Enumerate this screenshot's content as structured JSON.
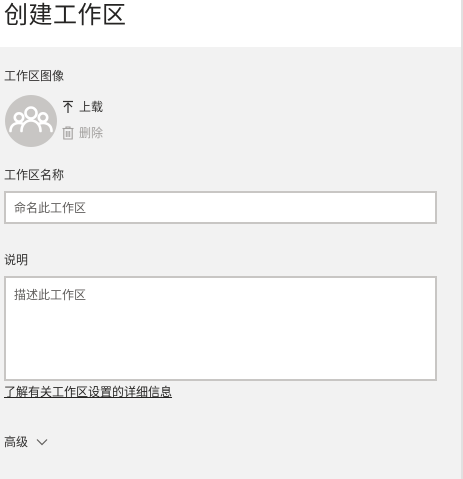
{
  "page": {
    "title": "创建工作区"
  },
  "image_section": {
    "label": "工作区图像",
    "avatar_icon": "group-icon",
    "upload_label": "上载",
    "upload_icon": "upload-arrow-icon",
    "delete_label": "删除",
    "delete_icon": "trash-icon"
  },
  "name_field": {
    "label": "工作区名称",
    "placeholder": "命名此工作区",
    "value": ""
  },
  "description_field": {
    "label": "说明",
    "placeholder": "描述此工作区",
    "value": ""
  },
  "learn_more_link": "了解有关工作区设置的详细信息",
  "advanced": {
    "label": "高级",
    "icon": "chevron-down-icon"
  },
  "colors": {
    "avatar_bg": "#c8c6c4",
    "input_border": "#c8c6c4",
    "panel_bg": "#f2f2f2",
    "disabled_text": "#a19f9d"
  }
}
